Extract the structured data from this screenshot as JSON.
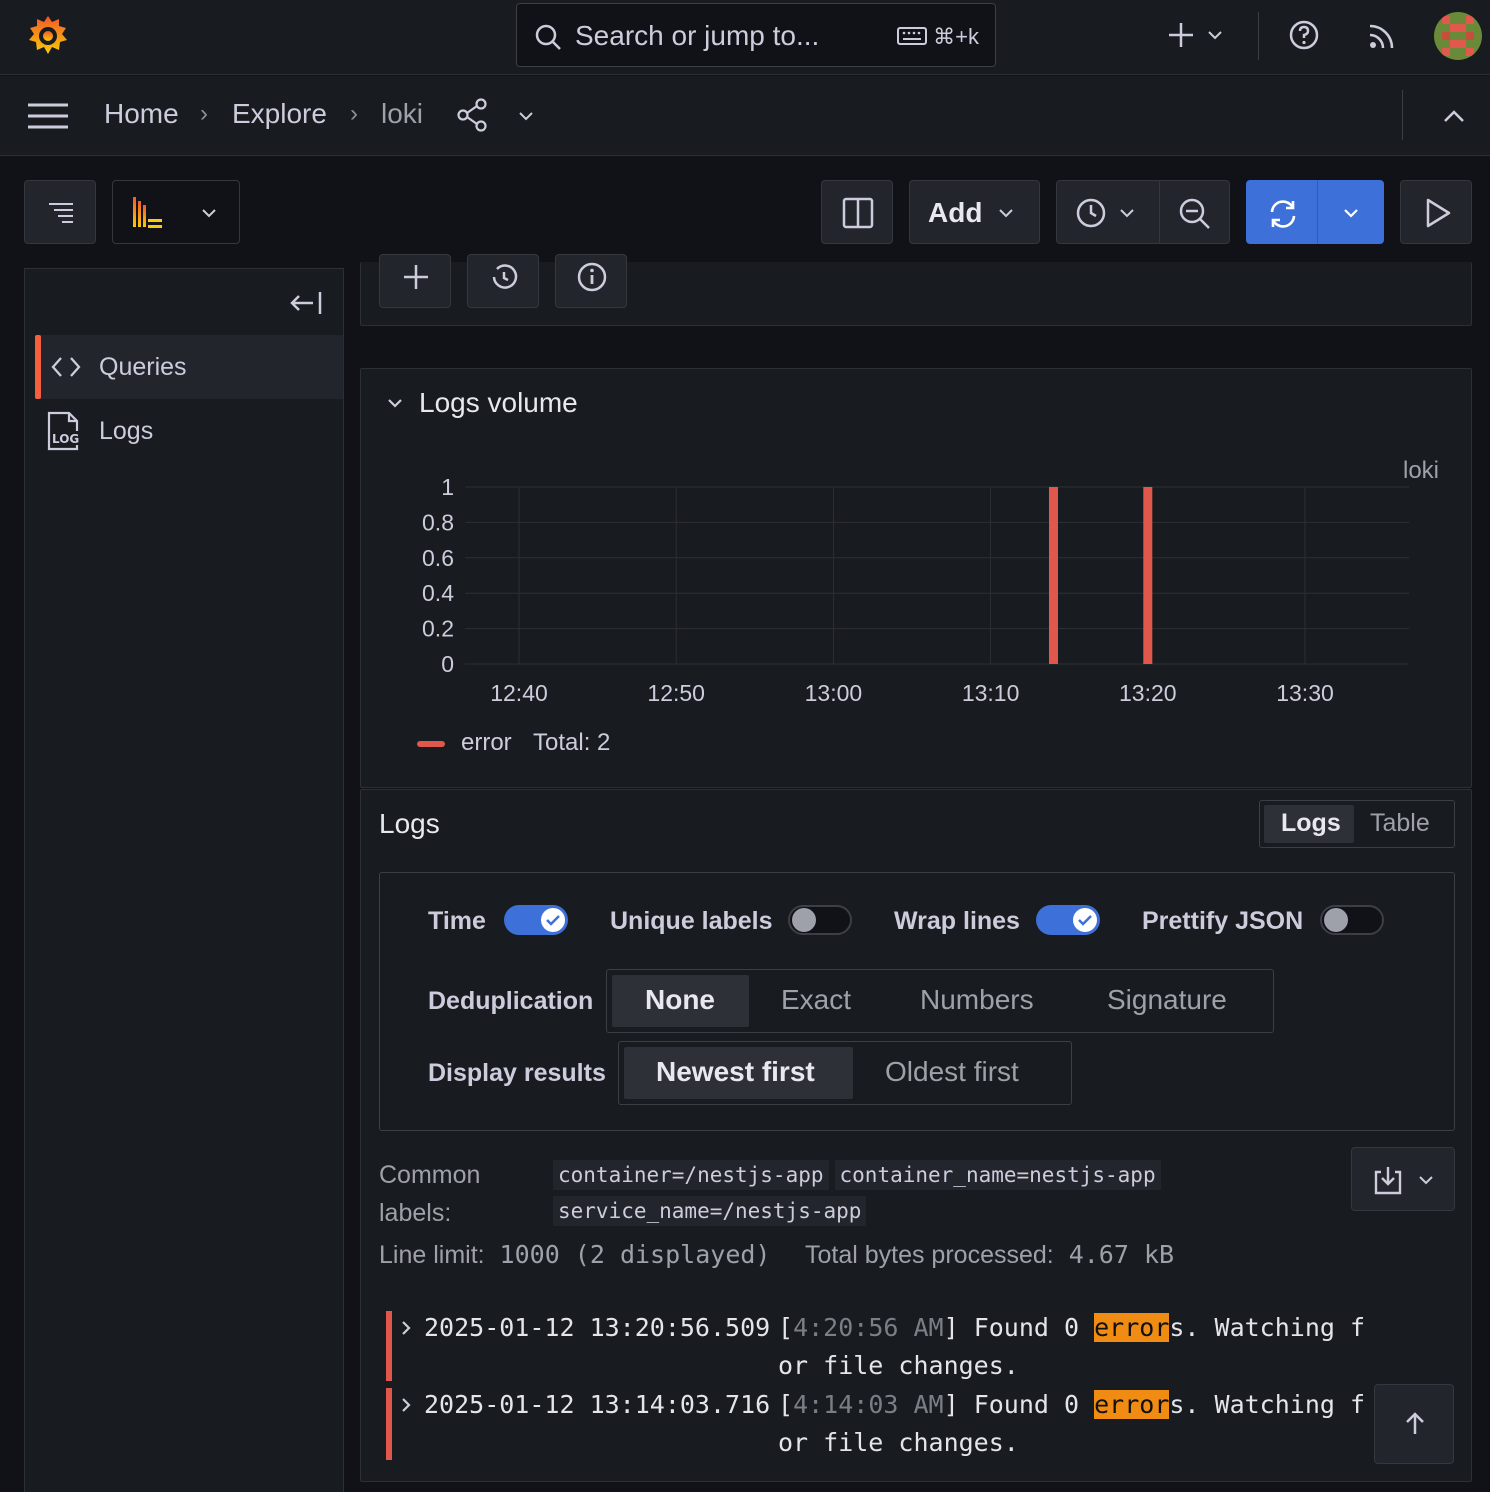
{
  "topbar": {
    "search_placeholder": "Search or jump to...",
    "shortcut": "⌘+k"
  },
  "breadcrumb": {
    "items": [
      "Home",
      "Explore",
      "loki"
    ]
  },
  "toolbar": {
    "add_label": "Add"
  },
  "sidebar": {
    "items": [
      {
        "label": "Queries",
        "active": true
      },
      {
        "label": "Logs",
        "active": false
      }
    ]
  },
  "logs_volume": {
    "title": "Logs volume",
    "datasource_label": "loki",
    "legend": {
      "series": "error",
      "total": "Total: 2"
    }
  },
  "chart_data": {
    "type": "bar",
    "y_ticks": [
      "1",
      "0.8",
      "0.6",
      "0.4",
      "0.2",
      "0"
    ],
    "x_ticks": [
      "12:40",
      "12:50",
      "13:00",
      "13:10",
      "13:20",
      "13:30"
    ],
    "ylim": [
      0,
      1
    ],
    "series": [
      {
        "name": "error",
        "color": "#e0584c",
        "points": [
          {
            "x": "13:14",
            "y": 1
          },
          {
            "x": "13:20",
            "y": 1
          }
        ]
      }
    ]
  },
  "logs": {
    "title": "Logs",
    "view_tabs": [
      "Logs",
      "Table"
    ],
    "options": {
      "time": "Time",
      "unique_labels": "Unique labels",
      "wrap_lines": "Wrap lines",
      "prettify_json": "Prettify JSON",
      "toggles": {
        "time": true,
        "unique_labels": false,
        "wrap_lines": true,
        "prettify_json": false
      },
      "dedup_label": "Deduplication",
      "dedup_options": [
        "None",
        "Exact",
        "Numbers",
        "Signature"
      ],
      "display_label": "Display results",
      "display_options": [
        "Newest first",
        "Oldest first"
      ]
    },
    "common_labels_title_1": "Common",
    "common_labels_title_2": "labels:",
    "common_labels": [
      "container=/nestjs-app",
      "container_name=nestjs-app",
      "service_name=/nestjs-app"
    ],
    "line_limit_label": "Line limit:",
    "line_limit_value": "1000 (2 displayed)",
    "bytes_label": "Total bytes processed:",
    "bytes_value": "4.67 kB",
    "rows": [
      {
        "timestamp": "2025-01-12 13:20:56.509",
        "time_bracket": "4:20:56 AM",
        "pre": "Found 0 ",
        "match": "error",
        "post": "s. Watching f",
        "line2": "or file changes."
      },
      {
        "timestamp": "2025-01-12 13:14:03.716",
        "time_bracket": "4:14:03 AM",
        "pre": "Found 0 ",
        "match": "error",
        "post": "s. Watching f",
        "line2": "or file changes."
      }
    ]
  }
}
